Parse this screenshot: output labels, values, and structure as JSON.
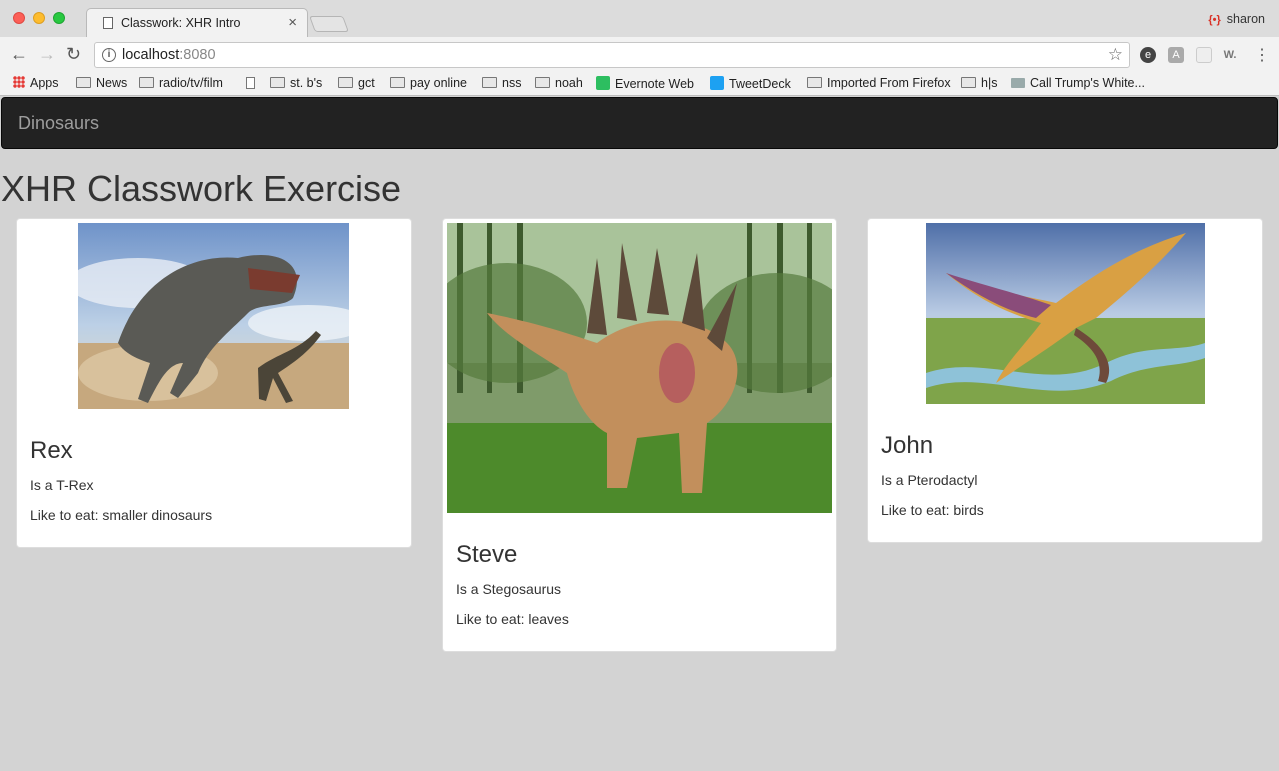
{
  "browser": {
    "tab_title": "Classwork: XHR Intro",
    "profile_name": "sharon",
    "url_host": "localhost",
    "url_port": ":8080",
    "bookmarks": [
      {
        "label": "Apps",
        "icon": "apps-icon"
      },
      {
        "label": "News",
        "icon": "folder-icon"
      },
      {
        "label": "radio/tv/film",
        "icon": "folder-icon"
      },
      {
        "label": "",
        "icon": "page-icon"
      },
      {
        "label": "st. b's",
        "icon": "folder-icon"
      },
      {
        "label": "gct",
        "icon": "folder-icon"
      },
      {
        "label": "pay online",
        "icon": "folder-icon"
      },
      {
        "label": "nss",
        "icon": "folder-icon"
      },
      {
        "label": "noah",
        "icon": "folder-icon"
      },
      {
        "label": "Evernote Web",
        "icon": "evernote-icon"
      },
      {
        "label": "TweetDeck",
        "icon": "tweetdeck-icon"
      },
      {
        "label": "Imported From Firefox",
        "icon": "folder-icon"
      },
      {
        "label": "h|s",
        "icon": "folder-icon"
      },
      {
        "label": "Call Trump's White...",
        "icon": "whitehouse-icon"
      }
    ]
  },
  "page": {
    "brand": "Dinosaurs",
    "heading": "XHR Classwork Exercise",
    "cards": [
      {
        "name": "Rex",
        "type": "Is a T-Rex",
        "food": "Like to eat: smaller dinosaurs",
        "image_icon": "t-rex-image"
      },
      {
        "name": "Steve",
        "type": "Is a Stegosaurus",
        "food": "Like to eat: leaves",
        "image_icon": "stegosaurus-image"
      },
      {
        "name": "John",
        "type": "Is a Pterodactyl",
        "food": "Like to eat: birds",
        "image_icon": "pterodactyl-image"
      }
    ]
  },
  "colors": {
    "page_background": "#d3d3d3",
    "navbar": "#222222",
    "brand_text": "#9d9d9d",
    "card_background": "#ffffff"
  }
}
